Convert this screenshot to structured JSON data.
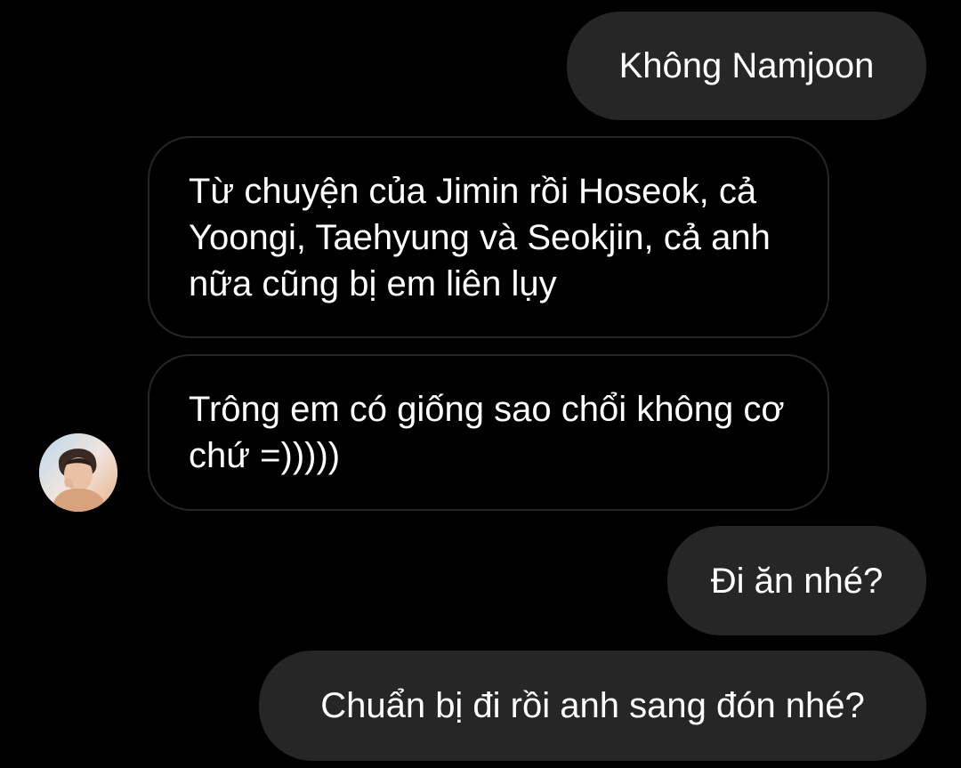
{
  "conversation": {
    "messages": [
      {
        "direction": "sent",
        "text": "Không Namjoon"
      },
      {
        "direction": "received",
        "text": "Từ chuyện của Jimin rồi Hoseok, cả Yoongi, Taehyung và Seokjin, cả anh nữa cũng bị em liên lụy"
      },
      {
        "direction": "received",
        "text": "Trông em có giống sao chổi không cơ chứ =)))))"
      },
      {
        "direction": "sent",
        "text": "Đi ăn nhé?"
      },
      {
        "direction": "sent",
        "text": "Chuẩn bị đi rồi anh sang đón nhé?"
      }
    ],
    "avatar_icon": "contact-avatar-photo"
  },
  "colors": {
    "background": "#000000",
    "sent_bubble": "#262626",
    "received_border": "#262626",
    "text": "#ffffff"
  }
}
